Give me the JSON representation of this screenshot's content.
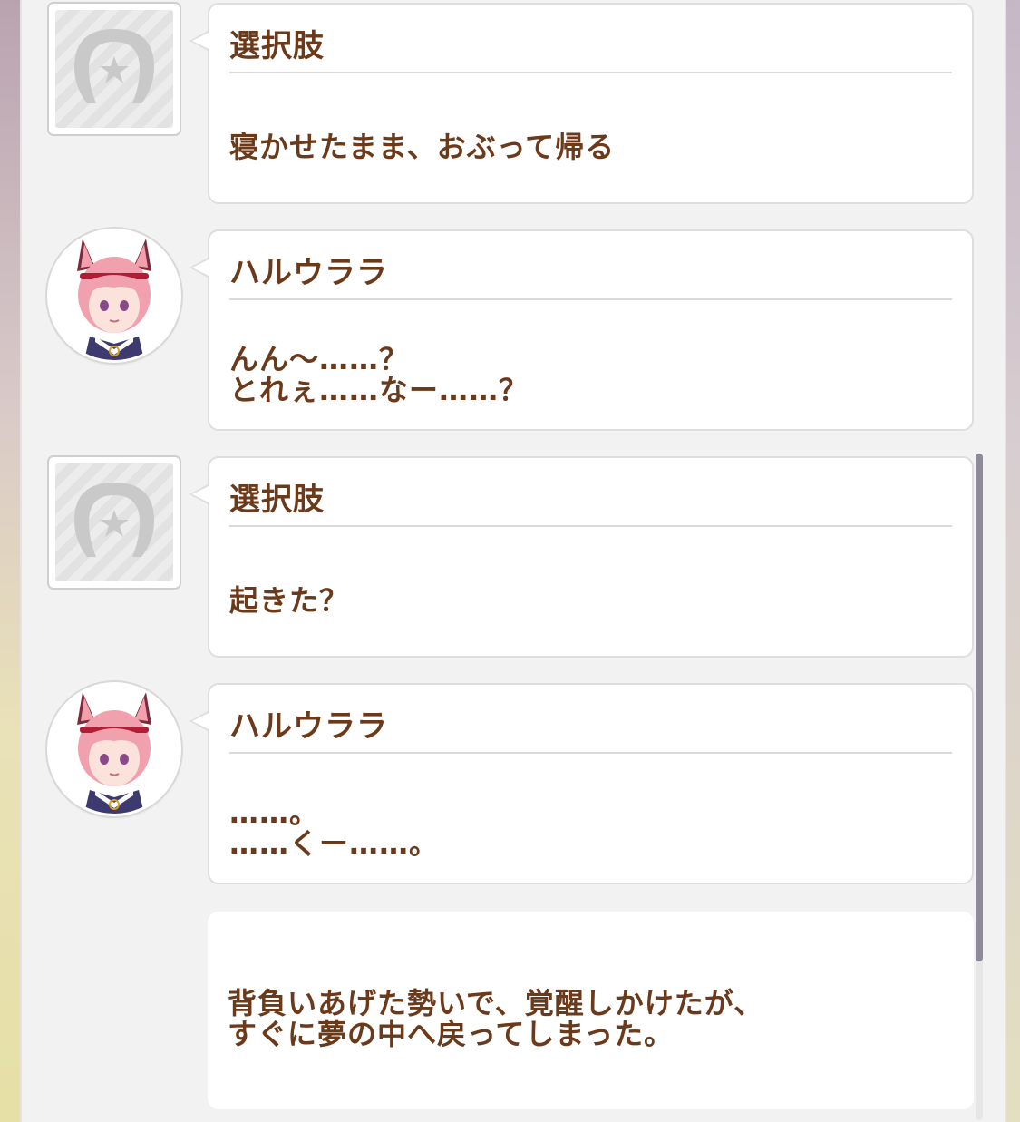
{
  "messages": [
    {
      "speaker": "選択肢",
      "avatar": "choice-horseshoe-icon",
      "lines": [
        "寝かせたまま、おぶって帰る"
      ]
    },
    {
      "speaker": "ハルウララ",
      "avatar": "haru-urara-avatar",
      "lines": [
        "んん～……？",
        "とれぇ……なー……？"
      ]
    },
    {
      "speaker": "選択肢",
      "avatar": "choice-horseshoe-icon",
      "lines": [
        "起きた？"
      ]
    },
    {
      "speaker": "ハルウララ",
      "avatar": "haru-urara-avatar",
      "lines": [
        "……。",
        "……くー……。"
      ]
    }
  ],
  "narration": {
    "lines": [
      "背負いあげた勢いで、覚醒しかけたが、",
      "すぐに夢の中へ戻ってしまった。"
    ]
  },
  "colors": {
    "text": "#6b3a1b",
    "panel": "#f2f2f2",
    "bubble": "#ffffff",
    "hair": "#f0a1ad",
    "ribbon": "#b21c35"
  }
}
